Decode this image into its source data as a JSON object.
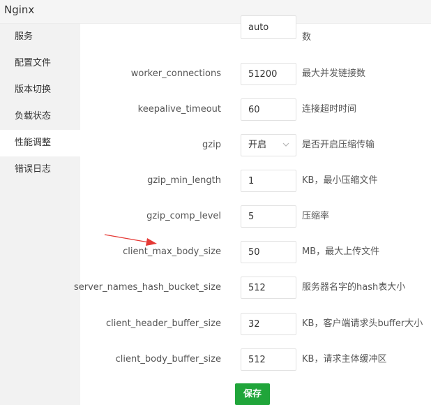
{
  "app": {
    "title": "Nginx"
  },
  "sidebar": {
    "active_index": 4,
    "items": [
      {
        "label": "服务"
      },
      {
        "label": "配置文件"
      },
      {
        "label": "版本切换"
      },
      {
        "label": "负载状态"
      },
      {
        "label": "性能调整"
      },
      {
        "label": "错误日志"
      }
    ]
  },
  "form": {
    "worker_processes": {
      "value": "auto",
      "note": "数"
    },
    "worker_connections": {
      "label": "worker_connections",
      "value": "51200",
      "note": "最大并发链接数"
    },
    "keepalive_timeout": {
      "label": "keepalive_timeout",
      "value": "60",
      "note": "连接超时时间"
    },
    "gzip": {
      "label": "gzip",
      "value": "开启",
      "note": "是否开启压缩传输",
      "icon": "chevron-down-icon"
    },
    "gzip_min_length": {
      "label": "gzip_min_length",
      "value": "1",
      "note": "KB，最小压缩文件"
    },
    "gzip_comp_level": {
      "label": "gzip_comp_level",
      "value": "5",
      "note": "压缩率"
    },
    "client_max_body_size": {
      "label": "client_max_body_size",
      "value": "50",
      "note": "MB，最大上传文件"
    },
    "server_names_hash_bucket_size": {
      "label": "server_names_hash_bucket_size",
      "value": "512",
      "note": "服务器名字的hash表大小"
    },
    "client_header_buffer_size": {
      "label": "client_header_buffer_size",
      "value": "32",
      "note": "KB，客户端请求头buffer大小"
    },
    "client_body_buffer_size": {
      "label": "client_body_buffer_size",
      "value": "512",
      "note": "KB，请求主体缓冲区"
    }
  },
  "actions": {
    "save_label": "保存"
  },
  "colors": {
    "accent": "#20a53a",
    "annotation_arrow": "#e53935"
  }
}
